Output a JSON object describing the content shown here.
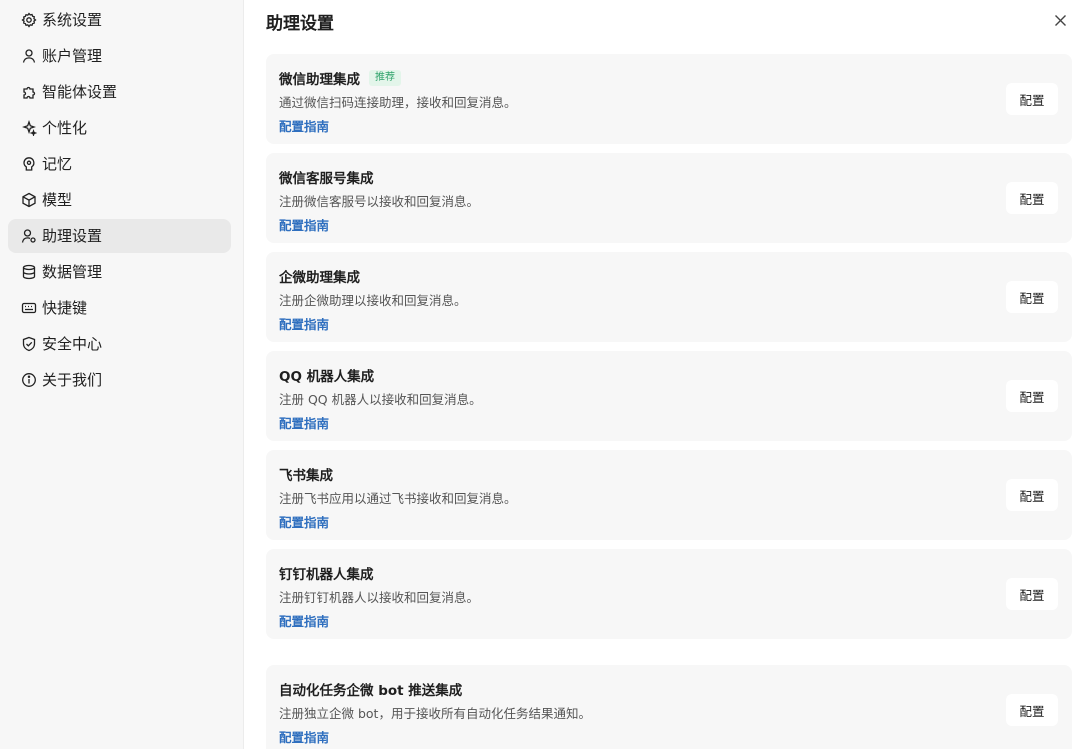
{
  "sidebar": {
    "items": [
      {
        "label": "系统设置",
        "icon": "gear-icon"
      },
      {
        "label": "账户管理",
        "icon": "user-icon"
      },
      {
        "label": "智能体设置",
        "icon": "puzzle-icon"
      },
      {
        "label": "个性化",
        "icon": "sparkle-icon"
      },
      {
        "label": "记忆",
        "icon": "brain-icon"
      },
      {
        "label": "模型",
        "icon": "cube-icon"
      },
      {
        "label": "助理设置",
        "icon": "user-gear-icon",
        "active": true
      },
      {
        "label": "数据管理",
        "icon": "database-icon"
      },
      {
        "label": "快捷键",
        "icon": "keyboard-icon"
      },
      {
        "label": "安全中心",
        "icon": "shield-icon"
      },
      {
        "label": "关于我们",
        "icon": "info-icon"
      }
    ]
  },
  "main": {
    "title": "助理设置",
    "cards": [
      {
        "title": "微信助理集成",
        "badge": "推荐",
        "desc": "通过微信扫码连接助理，接收和回复消息。",
        "link": "配置指南",
        "button": "配置"
      },
      {
        "title": "微信客服号集成",
        "desc": "注册微信客服号以接收和回复消息。",
        "link": "配置指南",
        "button": "配置"
      },
      {
        "title": "企微助理集成",
        "desc": "注册企微助理以接收和回复消息。",
        "link": "配置指南",
        "button": "配置"
      },
      {
        "title": "QQ 机器人集成",
        "desc": "注册 QQ 机器人以接收和回复消息。",
        "link": "配置指南",
        "button": "配置"
      },
      {
        "title": "飞书集成",
        "desc": "注册飞书应用以通过飞书接收和回复消息。",
        "link": "配置指南",
        "button": "配置"
      },
      {
        "title": "钉钉机器人集成",
        "desc": "注册钉钉机器人以接收和回复消息。",
        "link": "配置指南",
        "button": "配置"
      },
      {
        "title": "自动化任务企微 bot 推送集成",
        "desc": "注册独立企微 bot，用于接收所有自动化任务结果通知。",
        "link": "配置指南",
        "button": "配置"
      }
    ]
  },
  "colors": {
    "sidebar_bg": "#f7f7f7",
    "active_item_bg": "#e9e9e9",
    "card_bg": "#f7f7f7",
    "link": "#2f6fbf",
    "badge_text": "#2fa36b",
    "badge_bg": "#e3f5ea"
  }
}
